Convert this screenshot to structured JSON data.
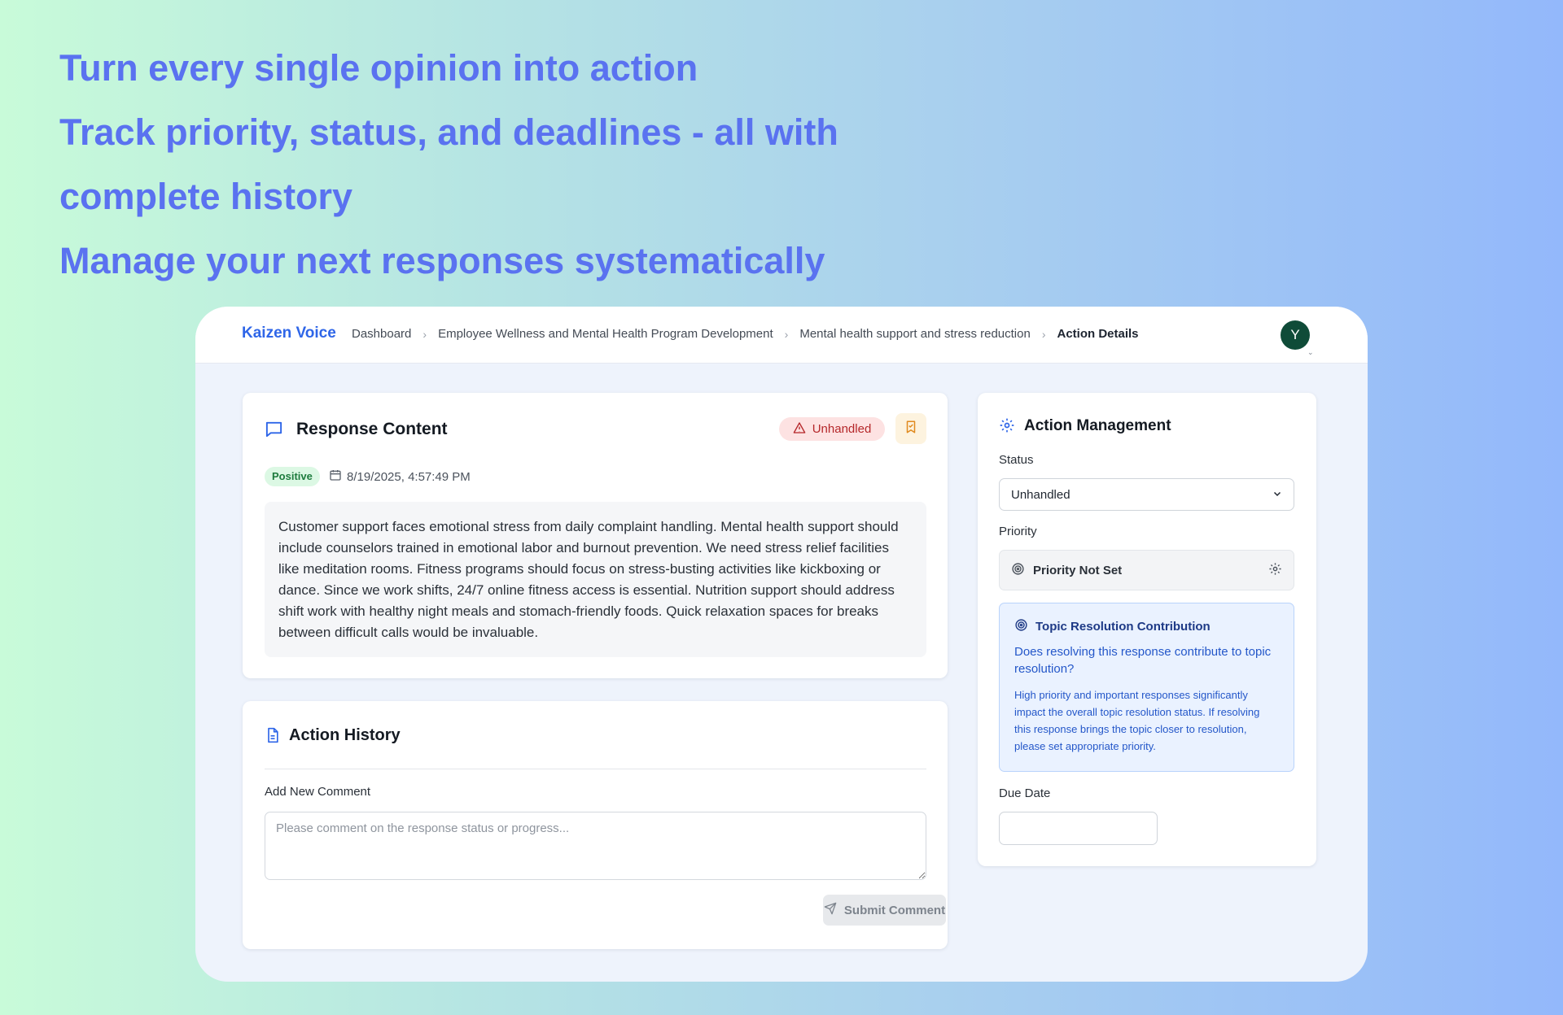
{
  "headline": [
    "Turn every single opinion into action",
    "Track priority, status, and deadlines - all with",
    "complete history",
    "Manage your next responses systematically"
  ],
  "header": {
    "brand": "Kaizen Voice",
    "breadcrumbs": [
      "Dashboard",
      "Employee Wellness and Mental Health Program Development",
      "Mental health support and stress reduction",
      "Action Details"
    ],
    "avatar_initial": "Y"
  },
  "response": {
    "title": "Response Content",
    "status_badge": "Unhandled",
    "sentiment": "Positive",
    "timestamp": "8/19/2025, 4:57:49 PM",
    "body": "Customer support faces emotional stress from daily complaint handling. Mental health support should include counselors trained in emotional labor and burnout prevention. We need stress relief facilities like meditation rooms. Fitness programs should focus on stress-busting activities like kickboxing or dance. Since we work shifts, 24/7 online fitness access is essential. Nutrition support should address shift work with healthy night meals and stomach-friendly foods. Quick relaxation spaces for breaks between difficult calls would be invaluable."
  },
  "history": {
    "title": "Action History",
    "comment_label": "Add New Comment",
    "comment_placeholder": "Please comment on the response status or progress...",
    "submit_label": "Submit Comment"
  },
  "management": {
    "title": "Action Management",
    "status_label": "Status",
    "status_value": "Unhandled",
    "priority_label": "Priority",
    "priority_value": "Priority Not Set",
    "info_title": "Topic Resolution Contribution",
    "info_question": "Does resolving this response contribute to topic resolution?",
    "info_text": "High priority and important responses significantly impact the overall topic resolution status. If resolving this response brings the topic closer to resolution, please set appropriate priority.",
    "due_date_label": "Due Date"
  },
  "colors": {
    "brand": "#2f66e8",
    "headline": "#5a72f0",
    "unhandled_bg": "#fde2e2",
    "unhandled_text": "#b5272a",
    "positive_bg": "#dcf8e4",
    "avatar": "#0f4b38"
  }
}
